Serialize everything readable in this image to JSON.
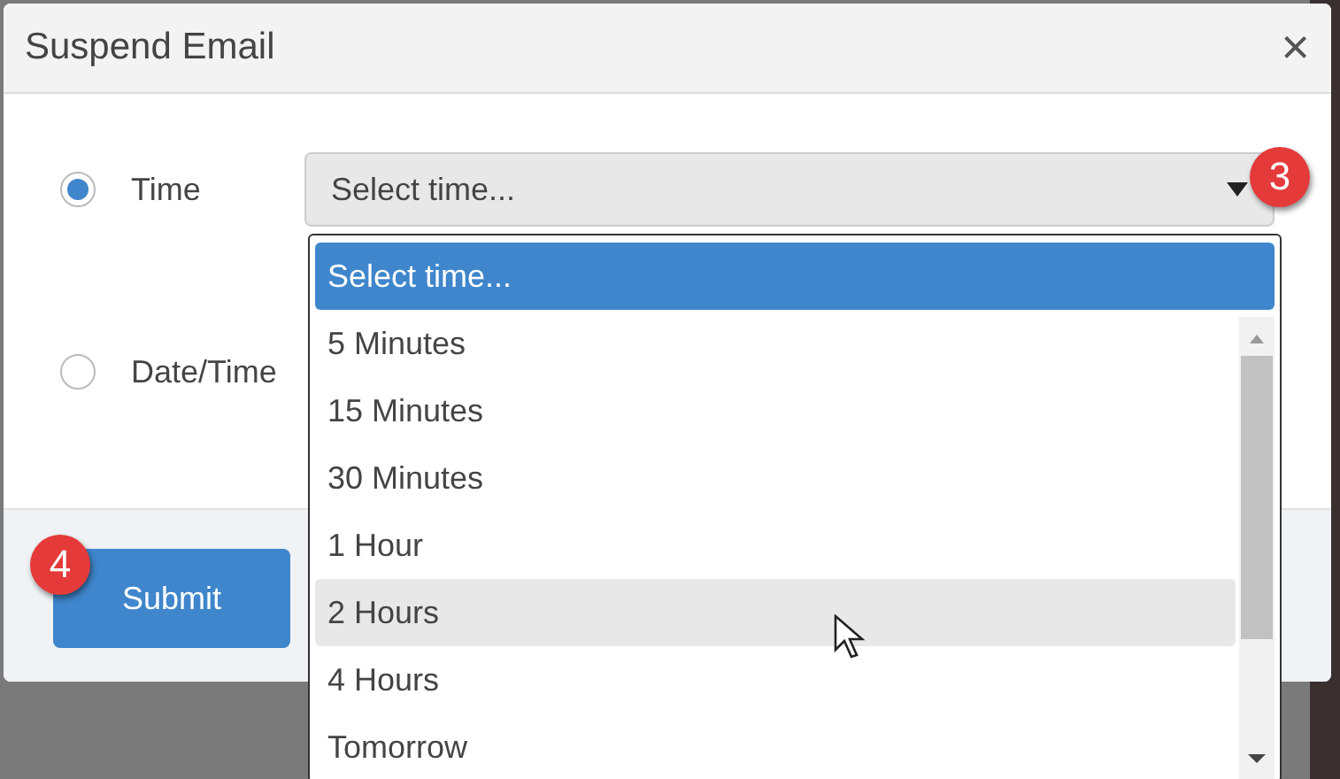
{
  "dialog": {
    "title": "Suspend Email",
    "close": "×"
  },
  "options": [
    {
      "label": "Time",
      "selected": true
    },
    {
      "label": "Date/Time",
      "selected": false
    }
  ],
  "select": {
    "value": "Select time..."
  },
  "dropdown": {
    "items": [
      {
        "label": "Select time...",
        "selected": true,
        "hovered": false
      },
      {
        "label": "5 Minutes",
        "selected": false,
        "hovered": false
      },
      {
        "label": "15 Minutes",
        "selected": false,
        "hovered": false
      },
      {
        "label": "30 Minutes",
        "selected": false,
        "hovered": false
      },
      {
        "label": "1 Hour",
        "selected": false,
        "hovered": false
      },
      {
        "label": "2 Hours",
        "selected": false,
        "hovered": true
      },
      {
        "label": "4 Hours",
        "selected": false,
        "hovered": false
      },
      {
        "label": "Tomorrow",
        "selected": false,
        "hovered": false
      }
    ]
  },
  "submit": "Submit",
  "callouts": [
    "3",
    "4"
  ]
}
